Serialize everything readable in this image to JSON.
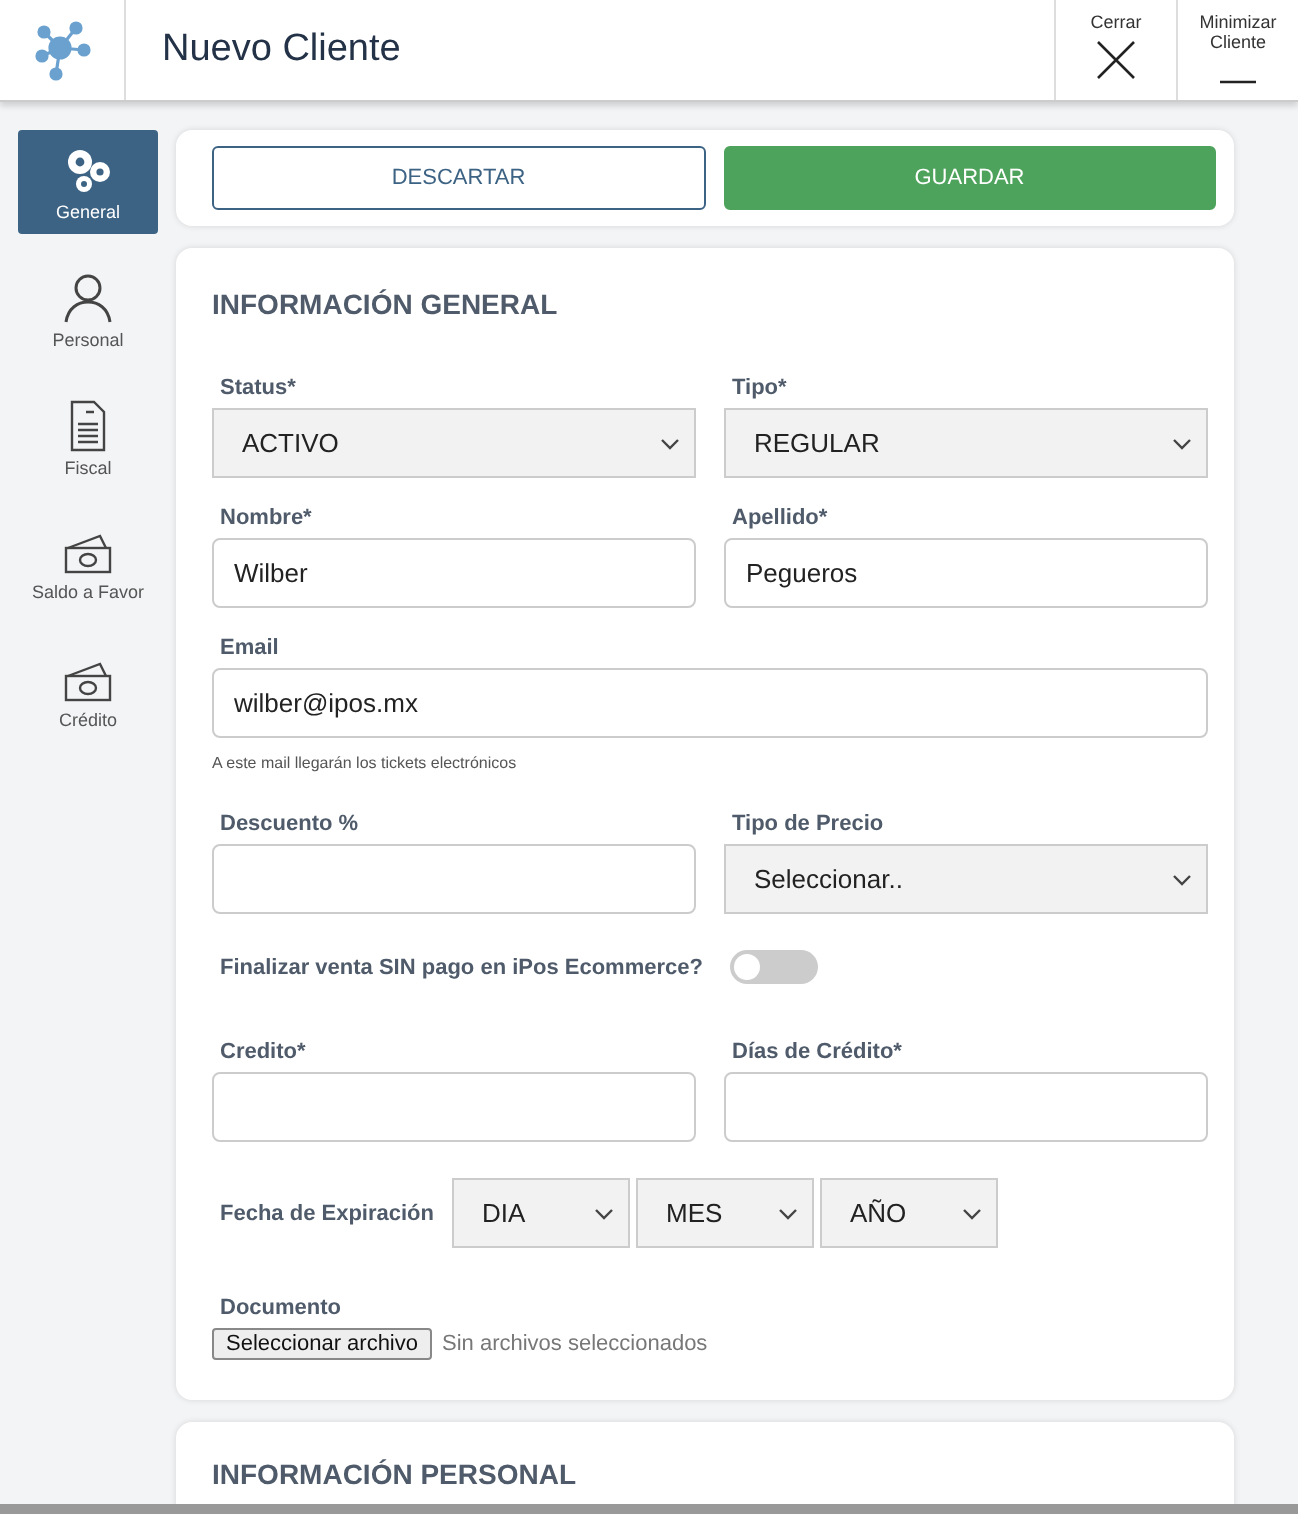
{
  "header": {
    "title": "Nuevo Cliente",
    "actions": [
      {
        "kind": "close",
        "label": "Cerrar"
      },
      {
        "kind": "minimize",
        "label": "Minimizar Cliente"
      }
    ]
  },
  "sidebar": {
    "items": [
      {
        "kind": "gears",
        "label": "General",
        "selected": true
      },
      {
        "kind": "person",
        "label": "Personal",
        "selected": false
      },
      {
        "kind": "document",
        "label": "Fiscal",
        "selected": false
      },
      {
        "kind": "money",
        "label": "Saldo a Favor",
        "selected": false
      },
      {
        "kind": "money",
        "label": "Crédito",
        "selected": false
      }
    ]
  },
  "actions": {
    "discard": "DESCARTAR",
    "save": "GUARDAR"
  },
  "form": {
    "title": "INFORMACIÓN GENERAL",
    "rows": [
      {
        "kind": "pair",
        "fields": [
          {
            "kind": "select",
            "label": "Status*",
            "value": "ACTIVO"
          },
          {
            "kind": "select",
            "label": "Tipo*",
            "value": "REGULAR"
          }
        ]
      },
      {
        "kind": "pair",
        "fields": [
          {
            "kind": "input",
            "label": "Nombre*",
            "value": "Wilber"
          },
          {
            "kind": "input",
            "label": "Apellido*",
            "value": "Pegueros"
          }
        ]
      },
      {
        "kind": "single",
        "field": {
          "kind": "input",
          "label": "Email",
          "value": "wilber@ipos.mx"
        },
        "hint": "A este mail llegarán los tickets electrónicos"
      },
      {
        "kind": "pair",
        "fields": [
          {
            "kind": "input",
            "label": "Descuento %"
          },
          {
            "kind": "select",
            "label": "Tipo de Precio",
            "value": "Seleccionar.."
          }
        ]
      },
      {
        "kind": "toggle",
        "label": "Finalizar venta SIN pago en iPos Ecommerce?",
        "on": false
      },
      {
        "kind": "pair",
        "fields": [
          {
            "kind": "input",
            "label": "Credito*"
          },
          {
            "kind": "input",
            "label": "Días de Crédito*"
          }
        ]
      },
      {
        "kind": "date",
        "label": "Fecha de Expiración",
        "selects": [
          "DIA",
          "MES",
          "AÑO"
        ]
      },
      {
        "kind": "file",
        "label": "Documento",
        "button": "Seleccionar archivo",
        "status": "Sin archivos seleccionados"
      }
    ]
  },
  "next_section": {
    "title": "INFORMACIÓN PERSONAL"
  }
}
